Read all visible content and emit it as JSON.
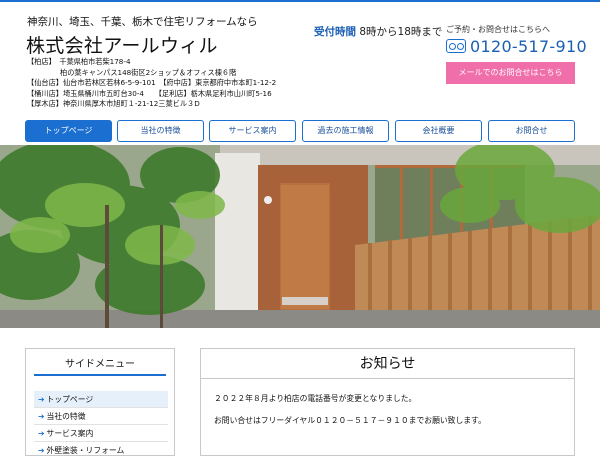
{
  "header": {
    "tagline": "神奈川、埼玉、千葉、栃木で住宅リフォームなら",
    "company_name": "株式会社アールウィル",
    "addresses": [
      "【柏店】　千葉県柏市若柴178-4",
      "柏の葉キャンパス148街区2ショップ＆オフィス棟６階",
      "【仙台店】仙台市若林区若林6-5-9-101　【府中店】東京都府中市本町1-12-2",
      "【桶川店】埼玉県桶川市五町台30-4　　【足利店】栃木県足利市山川町5-16",
      "【厚木店】神奈川県厚木市旭町１-21-12三葉ビル３D"
    ],
    "hours_label": "受付時間",
    "hours_value": "8時から18時まで",
    "contact_label": "ご予約・お問合せはこちらへ",
    "phone": "0120-517-910",
    "mail_button": "メールでのお問合せはこちら",
    "freedial_icon": "freedial-icon"
  },
  "nav": {
    "items": [
      "トップページ",
      "当社の特徴",
      "サービス案内",
      "過去の施工情報",
      "会社概要",
      "お問合せ"
    ],
    "active_index": 0
  },
  "sidebar": {
    "title": "サイドメニュー",
    "items": [
      "トップページ",
      "当社の特徴",
      "サービス案内",
      "外壁塗装・リフォーム"
    ]
  },
  "notice": {
    "title": "お知らせ",
    "paragraphs": [
      "２０２２年８月より柏店の電話番号が変更となりました。",
      "お問い合せはフリーダイヤル０１２０－５１７－９１０までお願い致します。"
    ]
  },
  "colors": {
    "accent": "#1a6fd0",
    "nav_text": "#1a4f9a",
    "mail_button": "#f06ea9"
  }
}
